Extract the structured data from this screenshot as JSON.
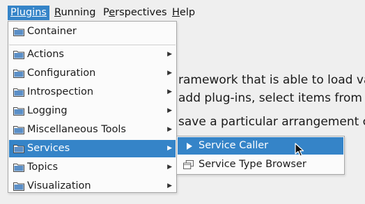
{
  "menubar": {
    "plugins": "Plugins",
    "running_u": "R",
    "running_rest": "unning",
    "perspectives_pre": "P",
    "perspectives_u": "e",
    "perspectives_rest": "rspectives",
    "help_u": "H",
    "help_rest": "elp"
  },
  "background_text": {
    "line1": "ramework that is able to load va",
    "line2": "add plug-ins, select items from t",
    "line3": "save a particular arrangement c"
  },
  "plugins_menu": {
    "items": [
      {
        "label": "Container",
        "submenu": false,
        "icon": "folder-icon"
      },
      {
        "label": "Actions",
        "submenu": true,
        "icon": "folder-icon"
      },
      {
        "label": "Configuration",
        "submenu": true,
        "icon": "folder-icon"
      },
      {
        "label": "Introspection",
        "submenu": true,
        "icon": "folder-icon"
      },
      {
        "label": "Logging",
        "submenu": true,
        "icon": "folder-icon"
      },
      {
        "label": "Miscellaneous Tools",
        "submenu": true,
        "icon": "folder-icon"
      },
      {
        "label": "Services",
        "submenu": true,
        "icon": "folder-icon",
        "highlighted": true
      },
      {
        "label": "Topics",
        "submenu": true,
        "icon": "folder-icon"
      },
      {
        "label": "Visualization",
        "submenu": true,
        "icon": "folder-icon"
      }
    ]
  },
  "services_submenu": {
    "items": [
      {
        "label": "Service Caller",
        "icon": "play-icon",
        "highlighted": true
      },
      {
        "label": "Service Type Browser",
        "icon": "window-icon"
      }
    ]
  },
  "colors": {
    "highlight": "#3584c8",
    "folder": "#5b8fc7"
  }
}
